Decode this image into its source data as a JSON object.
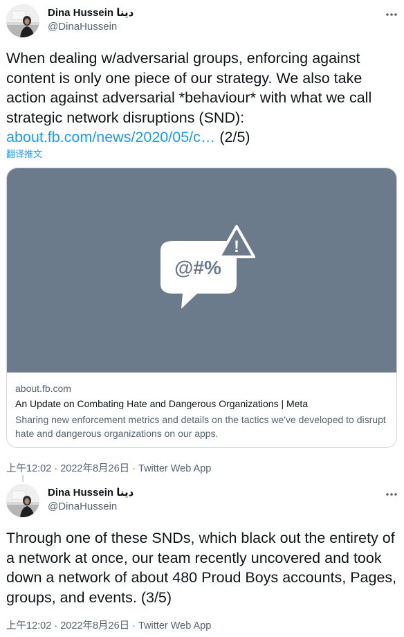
{
  "tweets": [
    {
      "author": {
        "name": "Dina Hussein دينا",
        "handle": "@DinaHussein"
      },
      "more_icon": "ellipsis-icon",
      "text_parts": {
        "body": "When dealing w/adversarial groups, enforcing against content is only one piece of our strategy. We also take action against adversarial *behaviour* with what we call strategic network disruptions (SND): ",
        "link": "about.fb.com/news/2020/05/c…",
        "suffix": " (2/5)"
      },
      "translate_label": "翻译推文",
      "card": {
        "image_icon": "speech-bubble-warning-icon",
        "image_text": "@#%",
        "image_warning": "!",
        "domain": "about.fb.com",
        "title": "An Update on Combating Hate and Dangerous Organizations | Meta",
        "description": "Sharing new enforcement metrics and details on the tactics we've developed to disrupt hate and dangerous organizations on our apps."
      },
      "meta": {
        "time": "上午12:02",
        "separator": " · ",
        "date": "2022年8月26日",
        "source": "Twitter Web App"
      }
    },
    {
      "author": {
        "name": "Dina Hussein دينا",
        "handle": "@DinaHussein"
      },
      "more_icon": "ellipsis-icon",
      "text": "Through one of these SNDs, which black out the entirety of a network at once, our team recently uncovered and took down a network of about 480 Proud Boys accounts, Pages, groups, and events. (3/5)",
      "meta": {
        "time": "上午12:02",
        "separator": " · ",
        "date": "2022年8月26日",
        "source": "Twitter Web App"
      }
    }
  ],
  "colors": {
    "link": "#1d9bf0",
    "secondary_text": "#536471",
    "card_image_bg": "#6b7b8c",
    "border": "#cfd9de"
  }
}
